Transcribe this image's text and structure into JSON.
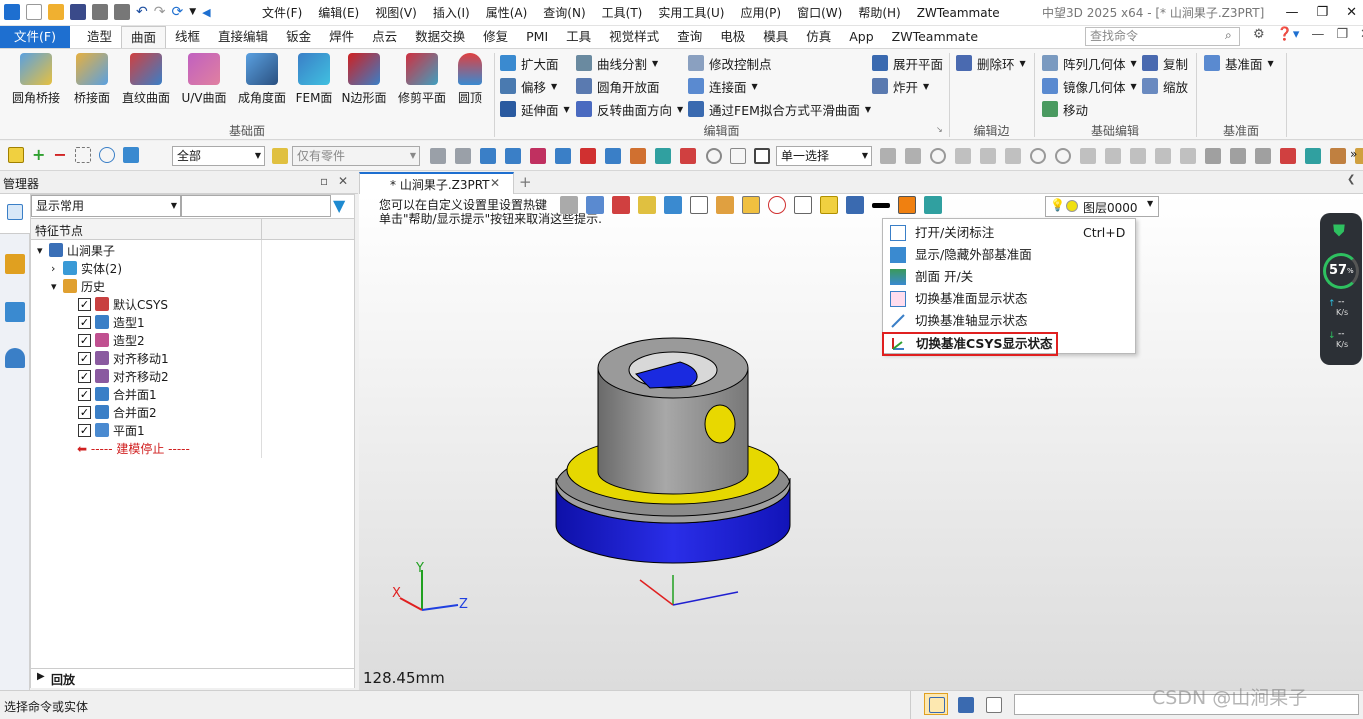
{
  "menubar": {
    "items": [
      "文件(F)",
      "编辑(E)",
      "视图(V)",
      "插入(I)",
      "属性(A)",
      "查询(N)",
      "工具(T)",
      "实用工具(U)",
      "应用(P)",
      "窗口(W)",
      "帮助(H)",
      "ZWTeammate"
    ],
    "title": "中望3D 2025 x64 - [* 山涧果子.Z3PRT]"
  },
  "ribbon_tabs": [
    "文件(F)",
    "造型",
    "曲面",
    "线框",
    "直接编辑",
    "钣金",
    "焊件",
    "点云",
    "数据交换",
    "修复",
    "PMI",
    "工具",
    "视觉样式",
    "查询",
    "电极",
    "模具",
    "仿真",
    "App",
    "ZWTeammate"
  ],
  "search": {
    "placeholder": "查找命令"
  },
  "ribbon": {
    "big_buttons": [
      "圆角桥接",
      "桥接面",
      "直纹曲面",
      "U/V曲面",
      "成角度面",
      "FEM面",
      "N边形面",
      "修剪平面",
      "圆顶"
    ],
    "group_basic": "基础面",
    "edit_col1": [
      "扩大面",
      "偏移",
      "延伸面"
    ],
    "edit_col2": [
      "曲线分割",
      "圆角开放面",
      "反转曲面方向"
    ],
    "edit_col3": [
      "修改控制点",
      "连接面",
      "通过FEM拟合方式平滑曲面"
    ],
    "edit_col4": [
      "展开平面",
      "炸开"
    ],
    "group_edit_face": "编辑面",
    "edge_btn": "删除环",
    "group_edit_edge": "编辑边",
    "basic_edit": [
      "阵列几何体",
      "镜像几何体",
      "移动"
    ],
    "basic_edit2": [
      "复制",
      "缩放"
    ],
    "group_basic_edit": "基础编辑",
    "datum_btn": "基准面",
    "group_datum": "基准面"
  },
  "toolbar2": {
    "filter": "全部",
    "part_filter": "仅有零件",
    "select_mode": "单一选择"
  },
  "manager": {
    "title": "管理器",
    "display_combo": "显示常用",
    "column_header": "特征节点",
    "tree": [
      {
        "label": "山涧果子",
        "level": 0,
        "checked": false,
        "arrow": "▾",
        "icon": "#3a6fb7"
      },
      {
        "label": "实体(2)",
        "level": 1,
        "checked": false,
        "arrow": "›",
        "icon": "#3a9ad6"
      },
      {
        "label": "历史",
        "level": 1,
        "checked": false,
        "arrow": "▾",
        "icon": "#e0a030"
      },
      {
        "label": "默认CSYS",
        "level": 2,
        "checked": true,
        "arrow": "",
        "icon": "#c84040"
      },
      {
        "label": "造型1",
        "level": 2,
        "checked": true,
        "arrow": "",
        "icon": "#3a7fc7"
      },
      {
        "label": "造型2",
        "level": 2,
        "checked": true,
        "arrow": "",
        "icon": "#c05090"
      },
      {
        "label": "对齐移动1",
        "level": 2,
        "checked": true,
        "arrow": "",
        "icon": "#8a5aa0"
      },
      {
        "label": "对齐移动2",
        "level": 2,
        "checked": true,
        "arrow": "",
        "icon": "#8a5aa0"
      },
      {
        "label": "合并面1",
        "level": 2,
        "checked": true,
        "arrow": "",
        "icon": "#3a7fc7"
      },
      {
        "label": "合并面2",
        "level": 2,
        "checked": true,
        "arrow": "",
        "icon": "#3a7fc7"
      },
      {
        "label": "平面1",
        "level": 2,
        "checked": true,
        "arrow": "",
        "icon": "#4a8ad0"
      }
    ],
    "stop_label": "----- 建模停止 -----",
    "rollback": "回放"
  },
  "doc_tab": "* 山涧果子.Z3PRT",
  "hint": {
    "line1": "您可以在自定义设置里设置热键",
    "line2": "单击\"帮助/显示提示\"按钮来取消这些提示."
  },
  "layer": "图层0000",
  "dropdown_menu": [
    {
      "label": "打开/关闭标注",
      "shortcut": "Ctrl+D",
      "highlighted": false
    },
    {
      "label": "显示/隐藏外部基准面",
      "shortcut": "",
      "highlighted": false
    },
    {
      "label": "剖面 开/关",
      "shortcut": "",
      "highlighted": false
    },
    {
      "label": "切换基准面显示状态",
      "shortcut": "",
      "highlighted": false
    },
    {
      "label": "切换基准轴显示状态",
      "shortcut": "",
      "highlighted": false
    },
    {
      "label": "切换基准CSYS显示状态",
      "shortcut": "",
      "highlighted": true
    }
  ],
  "measure": "128.45mm",
  "axes": {
    "x": "X",
    "y": "Y",
    "z": "Z"
  },
  "gauge": {
    "percent": "57",
    "unit": "%",
    "up": "--",
    "down": "--",
    "rate_unit": "K/s"
  },
  "status": {
    "text": "选择命令或实体"
  },
  "watermark": "CSDN @山涧果子",
  "colors": {
    "accent": "#1e6fd0",
    "highlight_box": "#e02020",
    "model_gray": "#8f8f8f",
    "model_yellow": "#e8d800",
    "model_blue": "#1a1ed0"
  }
}
